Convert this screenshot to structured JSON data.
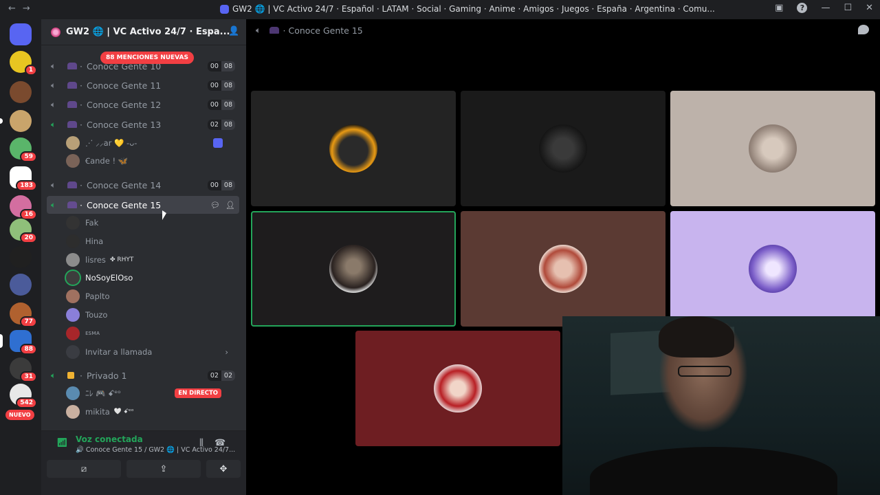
{
  "titlebar": {
    "back": "←",
    "forward": "→",
    "title": "GW2 🌐 | VC Activo 24/7 · Español · LATAM · Social · Gaming · Anime · Amigos · Juegos · España · Argentina · Comu...",
    "help": "?",
    "minimize": "—",
    "maximize": "☐",
    "close": "✕"
  },
  "guilds": [
    {
      "badge": ""
    },
    {
      "badge": "1"
    },
    {
      "badge": ""
    },
    {
      "badge": ""
    },
    {
      "badge": "59"
    },
    {
      "badge": "183"
    },
    {
      "badge": "16"
    },
    {
      "badge": "20"
    },
    {
      "badge": ""
    },
    {
      "badge": ""
    },
    {
      "badge": "77"
    },
    {
      "badge": "88"
    },
    {
      "badge": "31"
    },
    {
      "badge": "542"
    }
  ],
  "guild_new_label": "NUEVO",
  "server": {
    "name": "GW2 🌐 | VC Activo 24/7 · Espa...",
    "mentions": "88 MENCIONES NUEVAS"
  },
  "channels": [
    {
      "name": "Conoce Gente 10",
      "count": [
        "00",
        "08"
      ]
    },
    {
      "name": "Conoce Gente 11",
      "count": [
        "00",
        "08"
      ]
    },
    {
      "name": "Conoce Gente 12",
      "count": [
        "00",
        "08"
      ]
    },
    {
      "name": "Conoce Gente 13",
      "count": [
        "02",
        "08"
      ]
    },
    {
      "name": "Conoce Gente 14",
      "count": [
        "00",
        "08"
      ]
    },
    {
      "name": "Conoce Gente 15"
    },
    {
      "name": "Privado 1",
      "count": [
        "02",
        "02"
      ]
    }
  ],
  "ch13_users": [
    {
      "name": "⋰ ⸝⸝ar 💛 -ᴗ-"
    },
    {
      "name": "Ꞓande ! 🦋"
    }
  ],
  "ch15_users": [
    {
      "name": "Fak"
    },
    {
      "name": "Hina"
    },
    {
      "name": "lisres",
      "tag": "✤ RHYT"
    },
    {
      "name": "NoSoyElOso"
    },
    {
      "name": "Paplto"
    },
    {
      "name": "Touzo"
    },
    {
      "name": "ᴇꜱᴍᴀ"
    }
  ],
  "invite_label": "Invitar a llamada",
  "priv_users": [
    {
      "name": "ﾆﾚ 🎮 ꗃᵉᵒ"
    },
    {
      "name": "mikita",
      "tag": "🤍 ꗃᵉᵒ"
    }
  ],
  "live_label": "EN DIRECTO",
  "voice": {
    "status": "Voz conectada",
    "sub": "🔊 Conoce Gente 15 / GW2 🌐 | VC Activo 24/7...",
    "btn1": "⧄",
    "btn2": "⇪",
    "btn3": "✥"
  },
  "stage": {
    "channel": "Conoce Gente 15"
  },
  "colors": {
    "accent_green": "#23a55a",
    "mention_red": "#f23f43",
    "blurple": "#5865f2"
  }
}
